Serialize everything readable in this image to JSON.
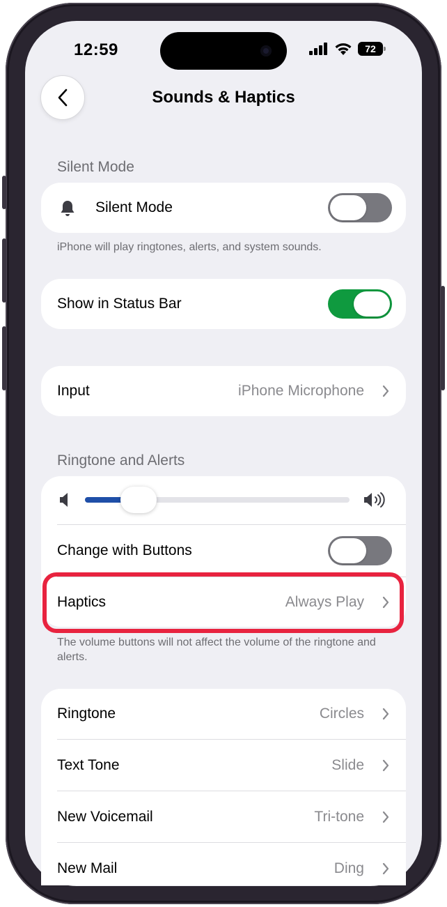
{
  "status_bar": {
    "time": "12:59",
    "battery": "72"
  },
  "nav": {
    "title": "Sounds & Haptics",
    "back_icon": "chevron-left-icon"
  },
  "silent_section": {
    "header": "Silent Mode",
    "silent_mode_label": "Silent Mode",
    "silent_mode_icon": "bell-icon",
    "silent_mode_on": false,
    "footer": "iPhone will play ringtones, alerts, and system sounds."
  },
  "status_bar_card": {
    "label": "Show in Status Bar",
    "on": true
  },
  "input_card": {
    "label": "Input",
    "value": "iPhone Microphone"
  },
  "ringtone_section": {
    "header": "Ringtone and Alerts",
    "volume_fraction": 0.16,
    "change_with_buttons_label": "Change with Buttons",
    "change_with_buttons_on": false,
    "haptics_label": "Haptics",
    "haptics_value": "Always Play",
    "footer": "The volume buttons will not affect the volume of the ringtone and alerts."
  },
  "tones": [
    {
      "label": "Ringtone",
      "value": "Circles"
    },
    {
      "label": "Text Tone",
      "value": "Slide"
    },
    {
      "label": "New Voicemail",
      "value": "Tri-tone"
    },
    {
      "label": "New Mail",
      "value": "Ding"
    }
  ],
  "colors": {
    "accent_green": "#0f9a3f",
    "slider_blue": "#1f4fa8",
    "highlight_red": "#e8233f"
  }
}
